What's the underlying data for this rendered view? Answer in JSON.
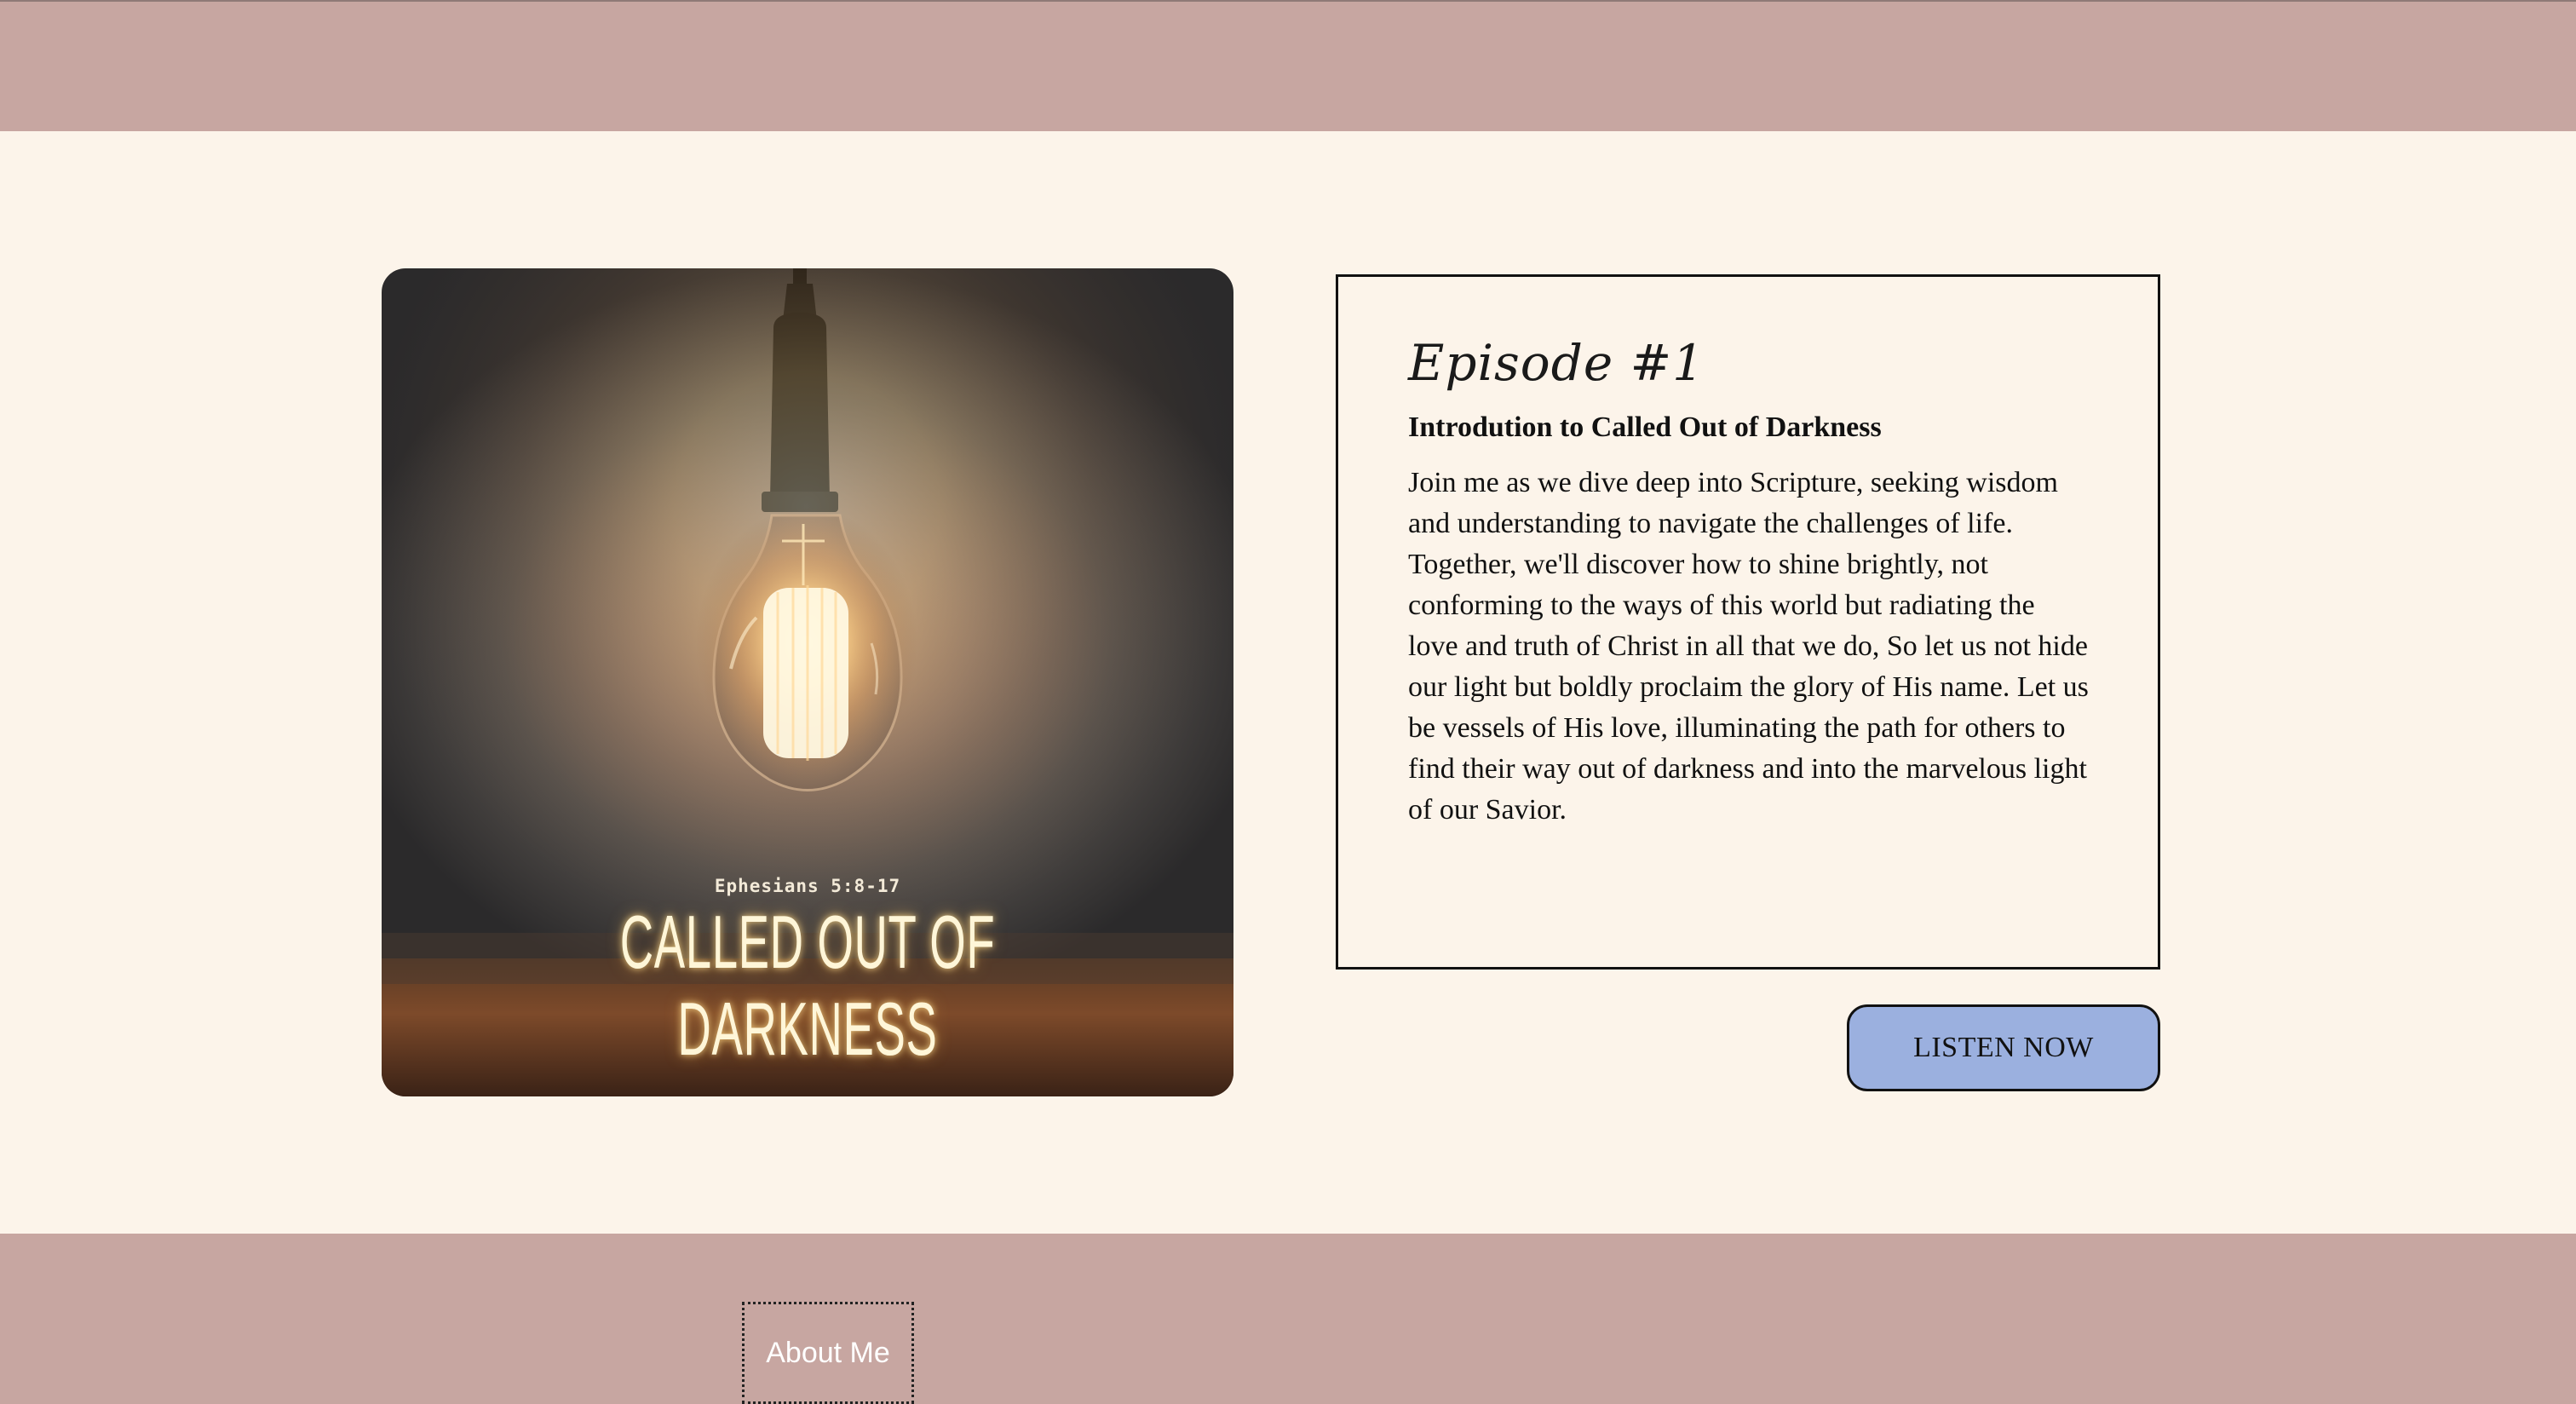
{
  "cover": {
    "verse_reference": "Ephesians 5:8-17",
    "title": "CALLED OUT OF DARKNESS"
  },
  "episode": {
    "label": "Episode #1",
    "title": "Introdution to Called Out of Darkness",
    "description": "Join me as we dive deep into Scripture, seeking wisdom and understanding to navigate the challenges of life. Together, we'll discover how to shine brightly, not conforming to the ways of this world but radiating the love and truth of Christ in all that we do, So let us not hide our light but boldly proclaim the glory of His name. Let us be vessels of His love, illuminating the path for others to find their way out of darkness and into the marvelous light of our Savior."
  },
  "actions": {
    "listen_label": "LISTEN NOW"
  },
  "footer": {
    "about_label": "About Me"
  },
  "colors": {
    "band": "#c7a6a1",
    "background": "#fcf4ea",
    "button": "#9bb0df"
  }
}
